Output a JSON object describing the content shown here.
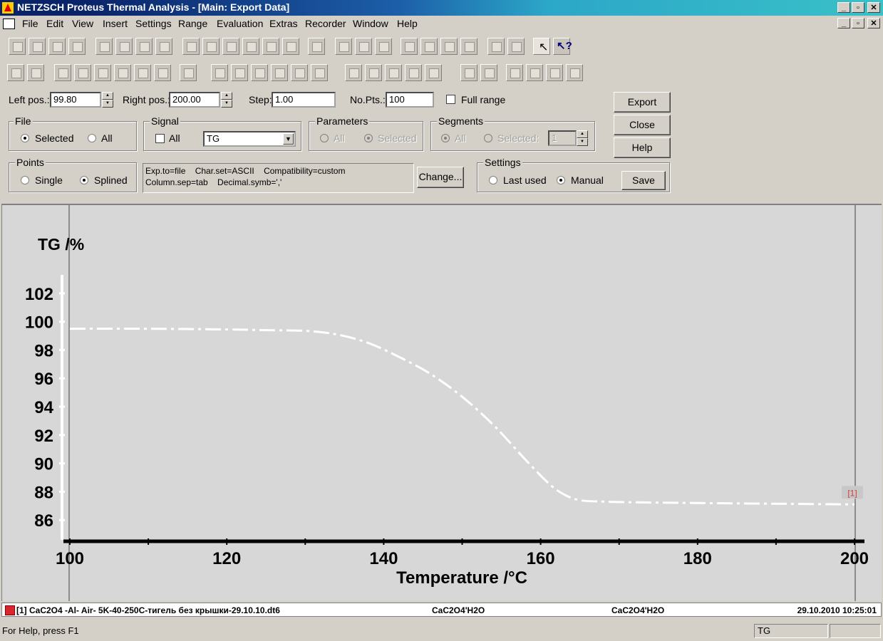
{
  "window": {
    "title": "NETZSCH Proteus Thermal Analysis - [Main: Export Data]"
  },
  "menu": [
    "File",
    "Edit",
    "View",
    "Insert",
    "Settings",
    "Range",
    "Evaluation",
    "Extras",
    "Recorder",
    "Window",
    "Help"
  ],
  "range": {
    "left_label": "Left pos.:",
    "left_value": "99.80",
    "right_label": "Right pos.:",
    "right_value": "200.00",
    "step_label": "Step:",
    "step_value": "1.00",
    "npts_label": "No.Pts.:",
    "npts_value": "100",
    "full_range_label": "Full range"
  },
  "file_group": {
    "title": "File",
    "selected": "Selected",
    "all": "All"
  },
  "signal_group": {
    "title": "Signal",
    "all": "All",
    "value": "TG"
  },
  "parameters_group": {
    "title": "Parameters",
    "all": "All",
    "selected": "Selected"
  },
  "segments_group": {
    "title": "Segments",
    "all": "All",
    "selected": "Selected:",
    "value": "1"
  },
  "points_group": {
    "title": "Points",
    "single": "Single",
    "splined": "Splined"
  },
  "export_info": {
    "line1": "Exp.to=file    Char.set=ASCII    Compatibility=custom",
    "line2": "Column.sep=tab    Decimal.symb=','"
  },
  "change_button": "Change...",
  "settings_group": {
    "title": "Settings",
    "last_used": "Last used",
    "manual": "Manual",
    "save": "Save"
  },
  "buttons": {
    "export": "Export",
    "close": "Close",
    "help": "Help"
  },
  "chart_data": {
    "type": "line",
    "ylabel": "TG /%",
    "xlabel": "Temperature /°C",
    "xlim": [
      100,
      200
    ],
    "ylim": [
      84.5,
      103.5
    ],
    "yticks": [
      86,
      88,
      90,
      92,
      94,
      96,
      98,
      100,
      102
    ],
    "xticks": [
      100,
      120,
      140,
      160,
      180,
      200
    ],
    "series": [
      {
        "marker": "[1]",
        "color": "#ffffff",
        "x": [
          100,
          110,
          120,
          125,
          130,
          134,
          138,
          142,
          146,
          150,
          154,
          158,
          161,
          163,
          165,
          168,
          172,
          180,
          190,
          200
        ],
        "y": [
          99.5,
          99.5,
          99.45,
          99.4,
          99.35,
          99.1,
          98.5,
          97.5,
          96.3,
          94.7,
          92.7,
          90.3,
          88.6,
          87.8,
          87.4,
          87.3,
          87.25,
          87.2,
          87.15,
          87.1
        ]
      }
    ]
  },
  "file_line": {
    "name": "[1] CaC2O4 -Al- Air- 5K-40-250C-тигель без крышки-29.10.10.dt6",
    "sample": "CaC2O4'H2O",
    "reference": "CaC2O4'H2O",
    "datetime": "29.10.2010 10:25:01"
  },
  "statusbar": {
    "help": "For Help, press F1",
    "signal": "TG"
  }
}
